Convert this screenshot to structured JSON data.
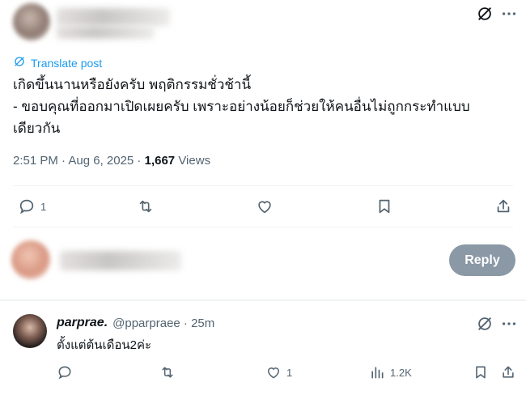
{
  "top": {
    "grok_icon": "grok-icon",
    "more_icon": "more-horizontal-icon"
  },
  "translate_label": "Translate post",
  "tweet": {
    "line1": "เกิดขึ้นนานหรือยังครับ พฤติกรรมชั่วช้านี้",
    "line2": "- ขอบคุณที่ออกมาเปิดเผยครับ เพราะอย่างน้อยก็ช่วยให้คนอื่นไม่ถูกกระทำแบบ",
    "line3": "เดียวกัน",
    "time": "2:51 PM · Aug 6, 2025 · ",
    "views_count": "1,667",
    "views_label": " Views"
  },
  "actions": {
    "reply_count": "1"
  },
  "compose": {
    "reply_button": "Reply"
  },
  "reply": {
    "name": "parprae.",
    "handle": "@pparpraee · 25m",
    "text": "ตั้งแต่ต้นเดือน2ค่ะ",
    "like_count": "1",
    "views_count": "1.2K"
  },
  "colors": {
    "accent": "#1d9bf0",
    "muted": "#536471",
    "reply_button_bg": "#8b98a5"
  }
}
